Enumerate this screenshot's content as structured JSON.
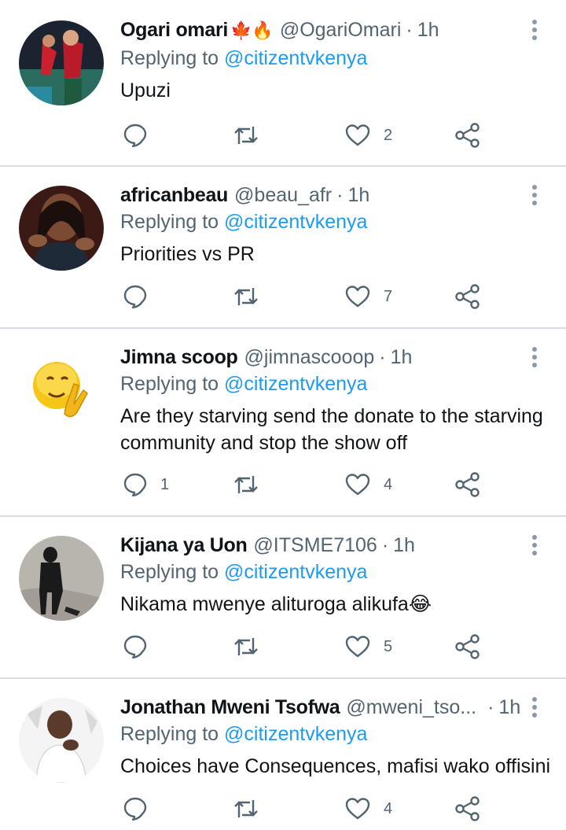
{
  "tweets": [
    {
      "name": "Ogari omari",
      "emoji": "🍁🔥",
      "handle": "@OgariOmari",
      "time": "1h",
      "replying_prefix": "Replying to",
      "replying_to": "@citizentvkenya",
      "text": "Upuzi",
      "reply_count": "",
      "retweet_count": "",
      "like_count": "2"
    },
    {
      "name": "africanbeau",
      "emoji": "",
      "handle": "@beau_afr",
      "time": "1h",
      "replying_prefix": "Replying to",
      "replying_to": "@citizentvkenya",
      "text": "Priorities vs PR",
      "reply_count": "",
      "retweet_count": "",
      "like_count": "7"
    },
    {
      "name": "Jimna scoop",
      "emoji": "",
      "handle": "@jimnascooop",
      "time": "1h",
      "replying_prefix": "Replying to",
      "replying_to": "@citizentvkenya",
      "text": "Are they starving send the donate to the starving community and stop the show off",
      "reply_count": "1",
      "retweet_count": "",
      "like_count": "4"
    },
    {
      "name": "Kijana ya Uon",
      "emoji": "",
      "handle": "@ITSME7106",
      "time": "1h",
      "replying_prefix": "Replying to",
      "replying_to": "@citizentvkenya",
      "text": "Nikama mwenye alituroga alikufa😂",
      "reply_count": "",
      "retweet_count": "",
      "like_count": "5"
    },
    {
      "name": "Jonathan Mweni Tsofwa",
      "emoji": "",
      "handle": "@mweni_tso...",
      "time": "1h",
      "replying_prefix": "Replying to",
      "replying_to": "@citizentvkenya",
      "text": "Choices have Consequences, mafisi wako offisini",
      "reply_count": "",
      "retweet_count": "",
      "like_count": "4"
    }
  ],
  "icons": {
    "reply": "reply-icon",
    "retweet": "retweet-icon",
    "like": "heart-icon",
    "share": "share-icon",
    "more": "more-vertical-icon"
  },
  "colors": {
    "text": "#0f1419",
    "secondary": "#536471",
    "link": "#1d9bf0",
    "divider": "#d9dde1"
  }
}
